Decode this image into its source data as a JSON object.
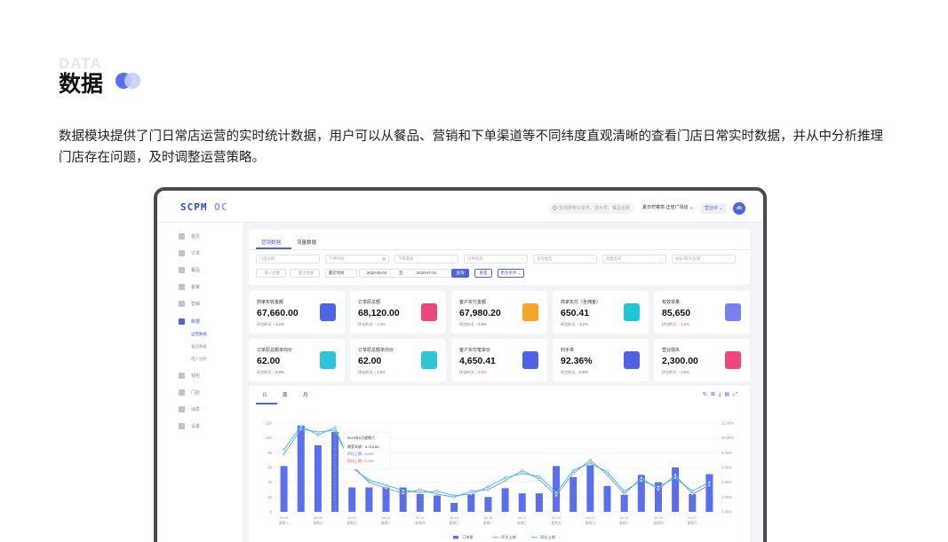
{
  "hero": {
    "ghost": "DATA",
    "title": "数据",
    "description": "数据模块提供了门日常店运营的实时统计数据，用户可以从餐品、营销和下单渠道等不同纬度直观清晰的查看门店日常实时数据，并从中分析推理门店存在问题，及时调整运营策略。"
  },
  "app": {
    "logo_main": "SCPM",
    "logo_sub": "OC",
    "search_placeholder": "支持搜索订单号、流水号、餐品名称",
    "store_name": "夏日柠檬茶·正佳广场店",
    "status": "营业中",
    "avatar": "db"
  },
  "sidebar": {
    "items": [
      {
        "label": "首页",
        "icon": "home-icon"
      },
      {
        "label": "订单",
        "icon": "order-icon"
      },
      {
        "label": "餐品",
        "icon": "dish-icon"
      },
      {
        "label": "备餐",
        "icon": "prep-icon"
      },
      {
        "label": "营销",
        "icon": "marketing-icon"
      },
      {
        "label": "数据",
        "icon": "chart-icon"
      },
      {
        "label": "钱包",
        "icon": "wallet-icon"
      },
      {
        "label": "门店",
        "icon": "store-icon"
      },
      {
        "label": "消息",
        "icon": "message-icon"
      },
      {
        "label": "设置",
        "icon": "settings-icon"
      }
    ],
    "sub_items": [
      "运营数据",
      "餐品数据",
      "用户分析"
    ]
  },
  "filters": {
    "tabs": [
      "营销数据",
      "流量数据"
    ],
    "fields": [
      "门店名称",
      "下单时间",
      "下单渠道",
      "订单状态",
      "会员类型",
      "金额区间",
      "省份/城市/区域"
    ],
    "min_amount": "最小金额",
    "max_amount": "最大金额",
    "range_type": "最近时间",
    "date_start": "2020-06-03",
    "date_to": "至",
    "date_end": "2020-07-04",
    "query": "查询",
    "reset": "重置",
    "more": "更多条件"
  },
  "stats": [
    {
      "label": "商家实收金额",
      "value": "67,660.00",
      "cmp": "环比昨天",
      "delta": "↓ 3.2%",
      "dir": "dn",
      "icon": "cash-register-icon",
      "color": "#4e62e6"
    },
    {
      "label": "订单原总额",
      "value": "68,120.00",
      "cmp": "环比昨天",
      "delta": "↑ 2.4%",
      "dir": "up",
      "icon": "money-bag-icon",
      "color": "#f0467b"
    },
    {
      "label": "客户实付金额",
      "value": "67,980.20",
      "cmp": "环比昨天",
      "delta": "↓ 5.8%",
      "dir": "dn",
      "icon": "wallet-icon",
      "color": "#f5a623"
    },
    {
      "label": "商家实付（含佣金）",
      "value": "650.41",
      "cmp": "环比昨天",
      "delta": "↓ 3.2%",
      "dir": "dn",
      "icon": "gift-box-icon",
      "color": "#1fc8d6"
    },
    {
      "label": "有效单量",
      "value": "85,650",
      "cmp": "环比昨天",
      "delta": "↑ 2.2%",
      "dir": "up",
      "icon": "receipt-icon",
      "color": "#7b7ef0"
    },
    {
      "label": "订单原总额单均价",
      "value": "62.00",
      "cmp": "环比昨天",
      "delta": "↓ 5.8%",
      "dir": "dn",
      "icon": "document-icon",
      "color": "#2bc6d9"
    },
    {
      "label": "订单原总额单均价",
      "value": "62.00",
      "cmp": "环比昨天",
      "delta": "↓ 3.6%",
      "dir": "dn",
      "icon": "document-icon",
      "color": "#2bc6d9"
    },
    {
      "label": "客户实付笔单价",
      "value": "4,650.41",
      "cmp": "环比昨天",
      "delta": "↑ 5.6%",
      "dir": "up",
      "icon": "user-icon",
      "color": "#4e62e6"
    },
    {
      "label": "利手率",
      "value": "92.36%",
      "cmp": "环比昨天",
      "delta": "↓ 5.8%",
      "dir": "dn",
      "icon": "hand-heart-icon",
      "color": "#4e62e6"
    },
    {
      "label": "营业损失",
      "value": "2,300.00",
      "cmp": "环比昨天",
      "delta": "↑ 0.8%",
      "dir": "up",
      "icon": "tickets-icon",
      "color": "#f0467b"
    }
  ],
  "chart": {
    "tabs": [
      "日",
      "周",
      "月"
    ],
    "tooltip": {
      "title": "2020年6月星期六",
      "row1": "商家实收：6,223.65",
      "row2": "环比上期 ↓ 5.6%",
      "row3": "同比上期 ↑ 5.0%"
    }
  },
  "chart_data": {
    "type": "bar",
    "categories": [
      "06-03",
      "06-04",
      "06-05",
      "06-06",
      "06-07",
      "06-08",
      "06-09",
      "06-10",
      "06-11",
      "06-12",
      "06-13",
      "06-14",
      "06-15",
      "06-16",
      "06-17",
      "06-18",
      "06-19",
      "06-20",
      "06-21",
      "06-22",
      "06-23",
      "06-24",
      "06-25",
      "06-26",
      "06-27",
      "06-28",
      "06-29",
      "06-30",
      "07-01",
      "07-02",
      "07-03",
      "07-04"
    ],
    "weekdays": [
      "星期三",
      "星期四",
      "星期五",
      "星期六",
      "星期日",
      "星期一",
      "星期二",
      "星期三",
      "星期四",
      "星期五",
      "星期六",
      "星期日",
      "星期一",
      "星期二",
      "星期三",
      "星期四",
      "星期五",
      "星期六",
      "星期日",
      "星期一",
      "星期二",
      "星期三",
      "星期四",
      "星期五",
      "星期六",
      "星期日",
      "星期一",
      "星期二",
      "星期三",
      "星期四",
      "星期五",
      "星期六"
    ],
    "series": [
      {
        "name": "订单量",
        "type": "bar",
        "values": [
          62,
          117,
          90,
          108,
          33,
          33,
          33,
          33,
          24,
          22,
          12,
          24,
          20,
          32,
          25,
          25,
          62,
          47,
          63,
          35,
          23,
          50,
          40,
          60,
          24,
          51,
          0,
          0,
          0,
          0,
          0,
          0
        ]
      },
      {
        "name": "环比上期",
        "type": "line",
        "values": [
          7.8,
          11.2,
          10.8,
          11.0,
          6.3,
          4.0,
          3.2,
          2.5,
          3.0,
          2.4,
          2.0,
          2.8,
          3.0,
          4.2,
          5.6,
          4.4,
          2.2,
          5.2,
          7.0,
          5.0,
          2.4,
          4.6,
          3.0,
          5.0,
          2.4,
          3.6
        ]
      },
      {
        "name": "同比上期",
        "type": "line",
        "values": [
          8.4,
          11.6,
          10.4,
          11.4,
          6.0,
          4.3,
          3.6,
          2.9,
          2.6,
          2.8,
          2.2,
          2.4,
          3.4,
          4.6,
          5.2,
          4.8,
          2.6,
          5.6,
          6.6,
          5.4,
          2.8,
          4.2,
          3.4,
          4.6,
          2.8,
          4.0
        ]
      }
    ],
    "yticks_left": [
      0,
      20,
      40,
      60,
      80,
      100,
      120
    ],
    "yticks_right": [
      "0.00%",
      "2.00%",
      "4.00%",
      "6.00%",
      "8.00%",
      "10.00%",
      "12.00%"
    ],
    "ylim": [
      0,
      120
    ],
    "ylim_right": [
      0,
      12
    ]
  },
  "colors": {
    "primary": "#4e62e6",
    "up": "#e64b5a",
    "bar": "#5b6df0",
    "line1": "#8a96f2",
    "line2": "#34c3dc"
  }
}
